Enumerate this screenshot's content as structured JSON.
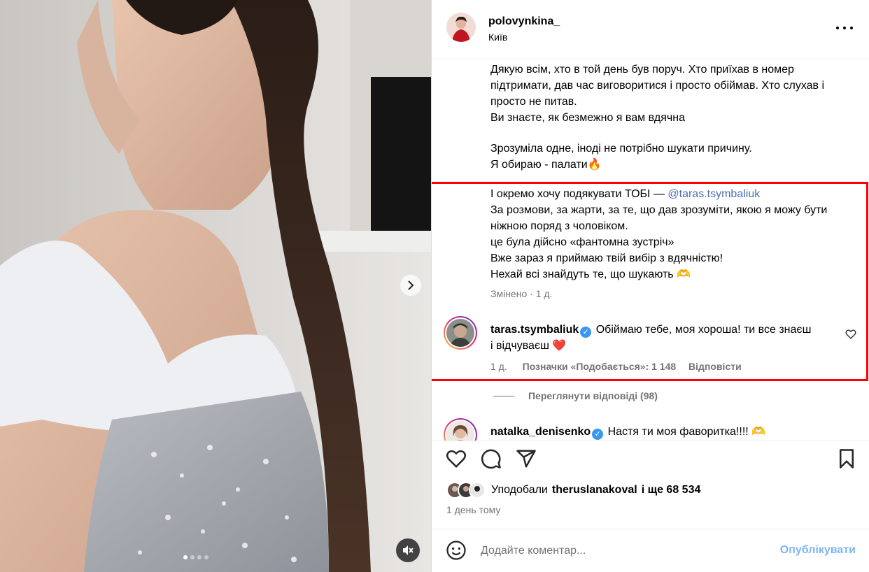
{
  "post": {
    "username": "polovynkina_",
    "location": "Київ",
    "more_icon": "more-horizontal-icon"
  },
  "caption": {
    "lines_a": [
      "Дякую всім, хто в той день був поруч. Хто приїхав в номер",
      "підтримати, дав час виговоритися і просто обіймав. Хто слухав і",
      "просто не питав.",
      "Ви знаєте, як безмежно я вам вдячна"
    ],
    "lines_b": [
      "Зрозуміла одне, іноді не потрібно шукати причину.",
      "Я обираю - палати🔥"
    ],
    "thanks_prefix": "І окремо хочу подякувати ТОБІ — ",
    "mention": "@taras.tsymbaliuk",
    "lines_c": [
      "За розмови, за жарти, за те, що дав зрозуміти, якою я можу бути",
      "ніжною поряд з чоловіком.",
      "це була дійсно «фантомна зустріч»",
      "Вже зараз я приймаю твій вибір з вдячністю!",
      "Нехай всі знайдуть те, що шукають 🫶"
    ],
    "edited_label": "Змінено",
    "edited_time": "1 д."
  },
  "comments": [
    {
      "username": "taras.tsymbaliuk",
      "verified": true,
      "text_line1": "Обіймаю тебе, моя хороша! ти все знаєш",
      "text_line2": "і відчуваєш ❤️",
      "time": "1 д.",
      "likes_label": "Позначки «Подобається»: 1 148",
      "reply_label": "Відповісти"
    },
    {
      "username": "natalka_denisenko",
      "verified": true,
      "text_line1": "Настя ти моя фаворитка!!!! 🫶"
    }
  ],
  "view_replies": "Переглянути відповіді (98)",
  "actions": {
    "icons": [
      "heart-icon",
      "comment-icon",
      "share-icon",
      "bookmark-icon"
    ],
    "liked_by_prefix": "Уподобали",
    "liked_by_user": "theruslanakoval",
    "liked_by_suffix": "і ще 68 534",
    "time_ago": "1 день тому"
  },
  "add_comment": {
    "placeholder": "Додайте коментар...",
    "post_label": "Опублікувати"
  },
  "colors": {
    "accent_link": "#4a6fb5",
    "verified": "#3897f0",
    "post_button": "#7cb5f5",
    "highlight": "#ff0000"
  }
}
